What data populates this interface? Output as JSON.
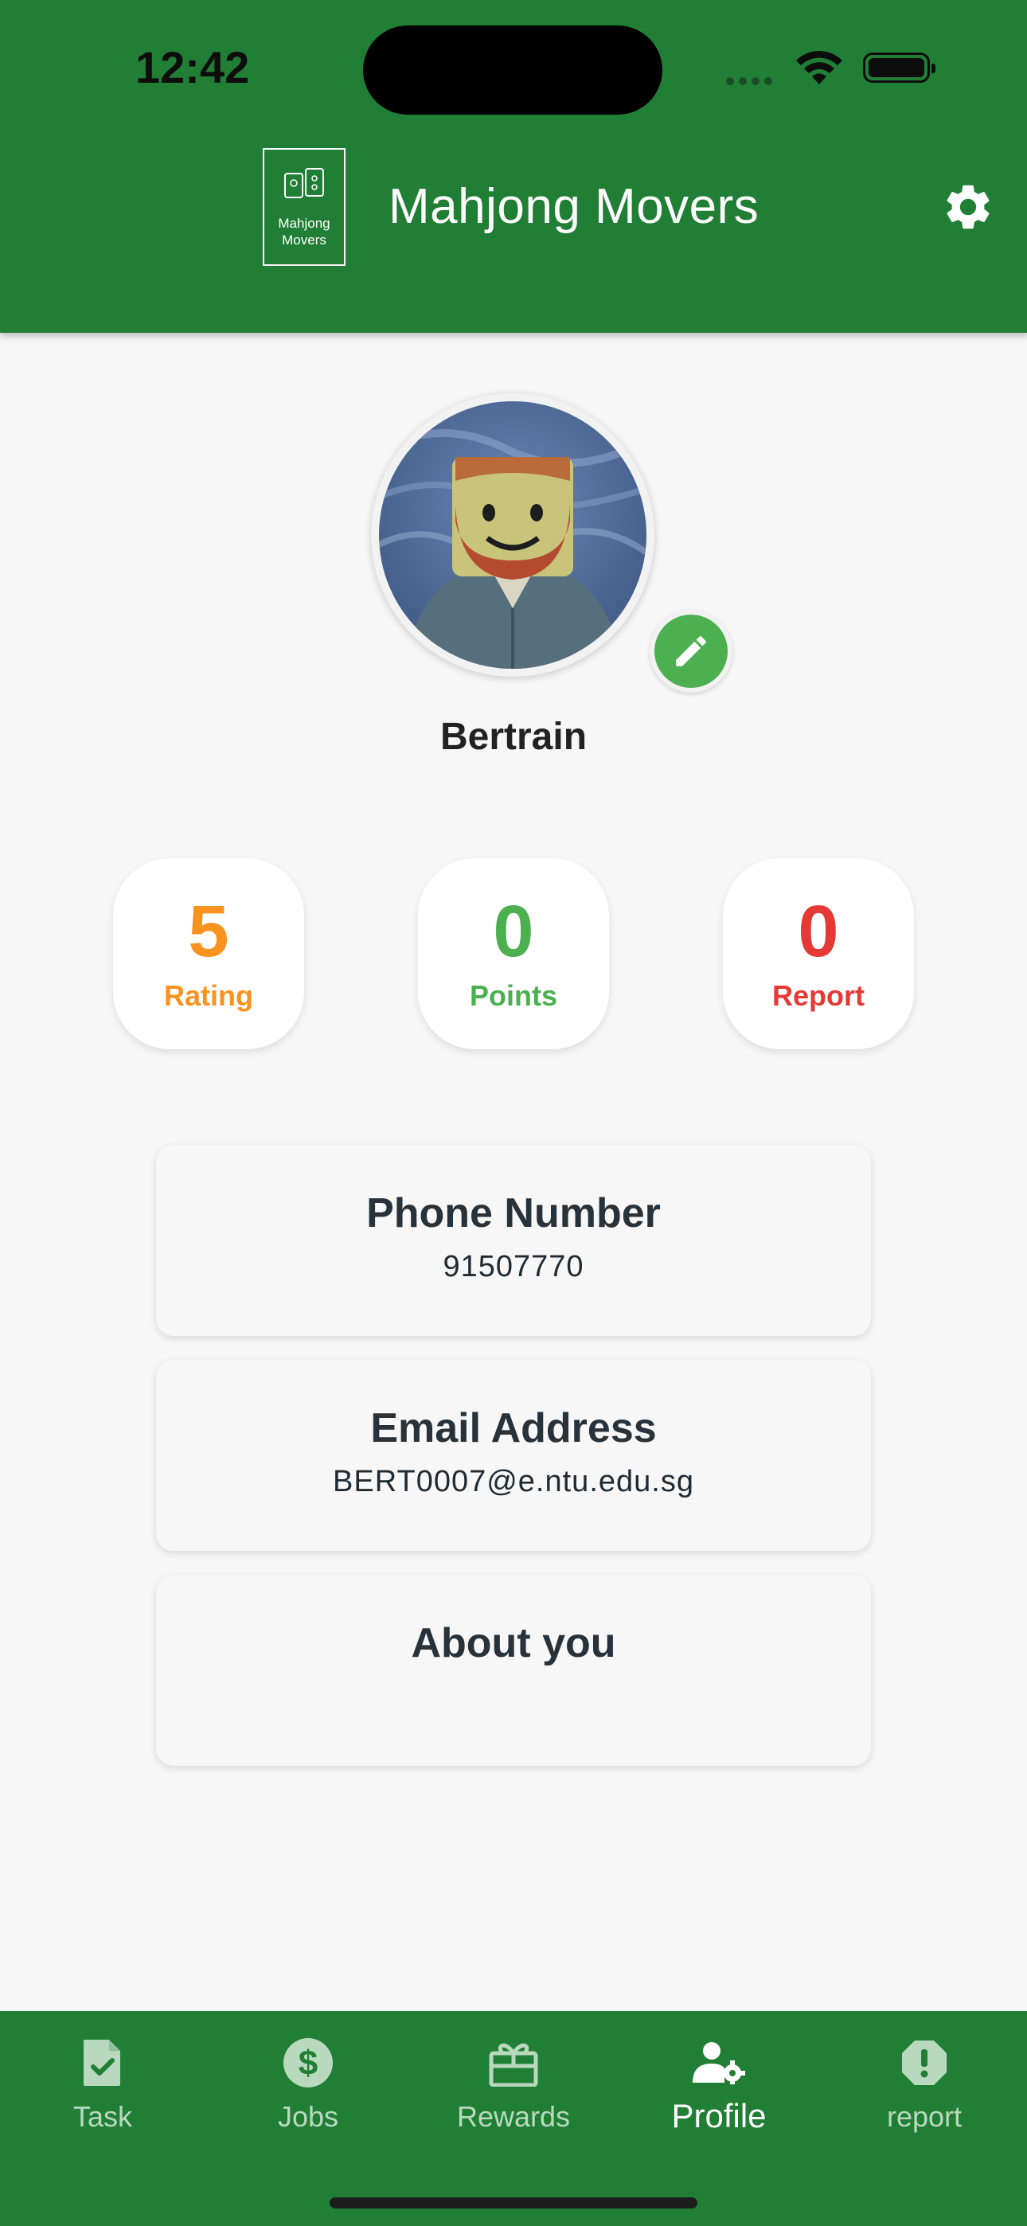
{
  "status_bar": {
    "time": "12:42"
  },
  "header": {
    "logo_line1": "Mahjong",
    "logo_line2": "Movers",
    "title": "Mahjong Movers",
    "settings_icon": "gear-icon"
  },
  "profile": {
    "name": "Bertrain",
    "edit_icon": "pencil-icon"
  },
  "stats": [
    {
      "value": "5",
      "label": "Rating",
      "color": "#f7931e"
    },
    {
      "value": "0",
      "label": "Points",
      "color": "#4caf50"
    },
    {
      "value": "0",
      "label": "Report",
      "color": "#e53935"
    }
  ],
  "cards": {
    "phone": {
      "title": "Phone Number",
      "value": "91507770"
    },
    "email": {
      "title": "Email Address",
      "value": "BERT0007@e.ntu.edu.sg"
    },
    "about": {
      "title": "About you",
      "value": ""
    }
  },
  "nav": {
    "items": [
      {
        "label": "Task",
        "icon": "task-file-check-icon"
      },
      {
        "label": "Jobs",
        "icon": "dollar-circle-icon"
      },
      {
        "label": "Rewards",
        "icon": "gift-icon"
      },
      {
        "label": "Profile",
        "icon": "user-gear-icon",
        "active": true
      },
      {
        "label": "report",
        "icon": "alert-circle-icon"
      }
    ]
  },
  "colors": {
    "primary_green": "#217f35",
    "accent_green": "#4caf50",
    "rating_orange": "#f7931e",
    "report_red": "#e53935"
  }
}
